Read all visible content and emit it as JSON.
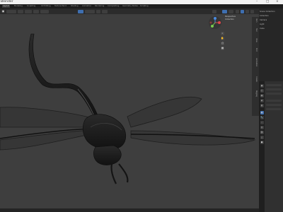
{
  "window": {
    "title": "Blender",
    "controls": [
      "–",
      "□",
      "×"
    ]
  },
  "menubar": {
    "tabs": [
      {
        "label": "Layout",
        "active": true
      },
      {
        "label": "Modeling",
        "active": false
      },
      {
        "label": "Sculpting",
        "active": false
      },
      {
        "label": "UV Editing",
        "active": false
      },
      {
        "label": "Texture Paint",
        "active": false
      },
      {
        "label": "Shading",
        "active": false
      },
      {
        "label": "Animation",
        "active": false
      },
      {
        "label": "Rendering",
        "active": false
      },
      {
        "label": "Compositing",
        "active": false
      },
      {
        "label": "Geometry Nodes",
        "active": false
      },
      {
        "label": "Scripting",
        "active": false
      }
    ]
  },
  "header": {
    "mode_label": "Object",
    "view_menu": "View",
    "select_menu": "Select",
    "add_menu": "Add",
    "object_menu": "Object",
    "global_label": "Global"
  },
  "viewport": {
    "overlay_labels": [
      "Perspective",
      "Collection"
    ],
    "gizmo_axes": {
      "x": "#e0474c",
      "y": "#7aca4e",
      "z": "#4a8bdf"
    }
  },
  "outliner": {
    "rows": [
      "Scene Collection",
      "Collection",
      "Camera",
      "Light",
      "Cube"
    ]
  },
  "side_tabs": [
    "Item",
    "Tool",
    "View",
    "Edit",
    "Animation",
    "Create",
    "Rigging"
  ],
  "colors": {
    "accent": "#3f6fb0",
    "viewport_bg": "#3e3e3e",
    "wire": "#1c1c1c"
  }
}
